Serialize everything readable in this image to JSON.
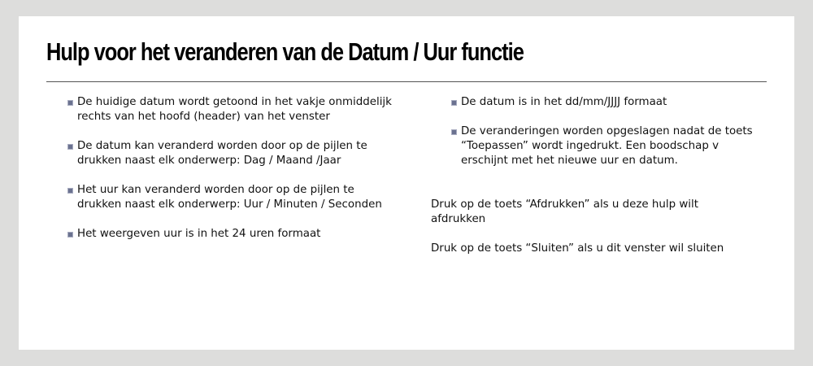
{
  "title": "Hulp voor het veranderen van de Datum / Uur functie",
  "left_bullets": [
    "De huidige datum wordt getoond in het vakje onmiddelijk rechts van het hoofd (header) van het venster",
    "De datum kan veranderd worden door op de pijlen te drukken naast elk onderwerp: Dag / Maand /Jaar",
    "Het uur kan veranderd worden door op de pijlen te drukken naast elk onderwerp: Uur / Minuten / Seconden",
    "Het weergeven uur is in het 24 uren formaat"
  ],
  "right_bullets": [
    "De datum is in het dd/mm/JJJJ formaat",
    "De veranderingen worden opgeslagen nadat de toets “Toepassen”  wordt ingedrukt. Een boodschap v erschijnt met het nieuwe uur en datum."
  ],
  "print_note": "Druk op de toets “Afdrukken” als u deze hulp wilt afdrukken",
  "close_note": "Druk op de toets “Sluiten” als u dit venster wil sluiten",
  "colors": {
    "background": "#dddddc",
    "panel": "#ffffff",
    "bullet": "#6b7290",
    "divider": "#555555"
  },
  "icons": {
    "bullet": "square-bullet-icon"
  }
}
